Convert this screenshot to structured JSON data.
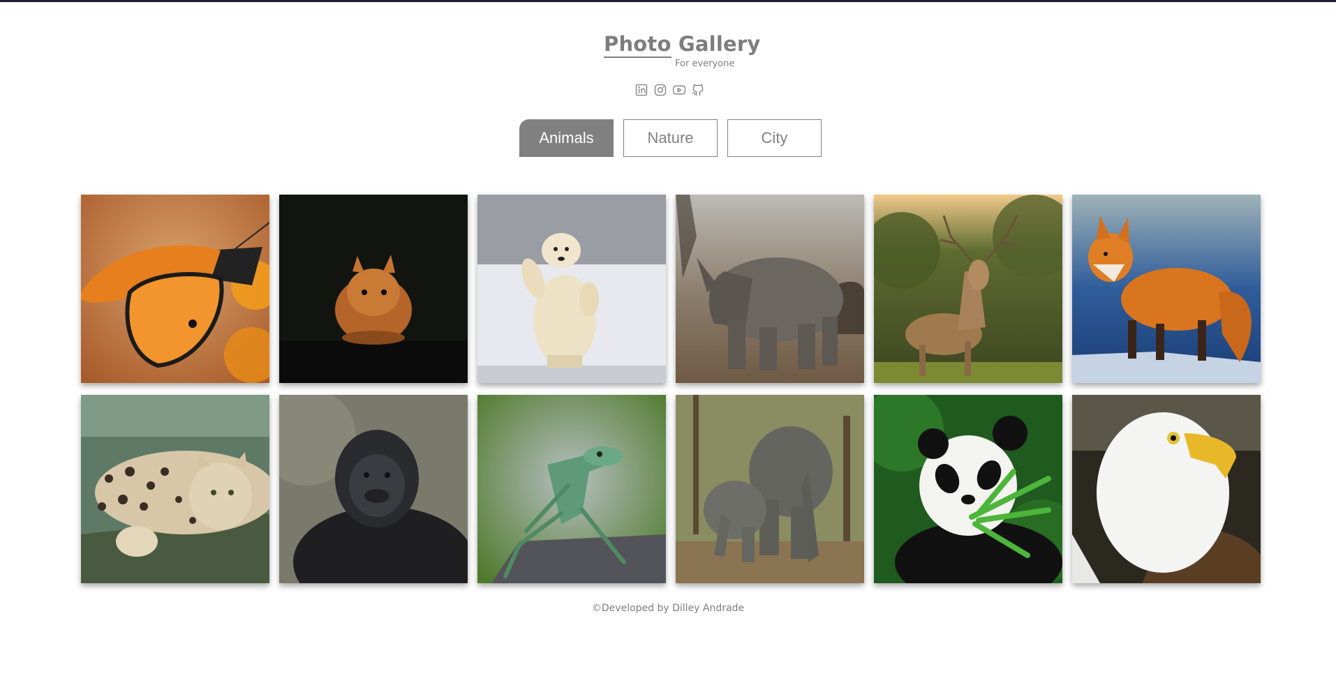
{
  "header": {
    "title_word1": "Photo",
    "title_word2": "Gallery",
    "subtitle": "For everyone"
  },
  "socials": [
    {
      "icon": "linkedin-icon"
    },
    {
      "icon": "instagram-icon"
    },
    {
      "icon": "youtube-icon"
    },
    {
      "icon": "github-icon"
    }
  ],
  "tabs": [
    {
      "label": "Animals",
      "active": true
    },
    {
      "label": "Nature",
      "active": false
    },
    {
      "label": "City",
      "active": false
    }
  ],
  "photos": [
    {
      "subject": "butterfly"
    },
    {
      "subject": "squirrel"
    },
    {
      "subject": "polar-bear"
    },
    {
      "subject": "rhino"
    },
    {
      "subject": "deer"
    },
    {
      "subject": "fox"
    },
    {
      "subject": "leopard"
    },
    {
      "subject": "gorilla"
    },
    {
      "subject": "lizard"
    },
    {
      "subject": "elephants"
    },
    {
      "subject": "panda"
    },
    {
      "subject": "eagle"
    }
  ],
  "footer": {
    "text": "©Developed by Dilley Andrade"
  }
}
